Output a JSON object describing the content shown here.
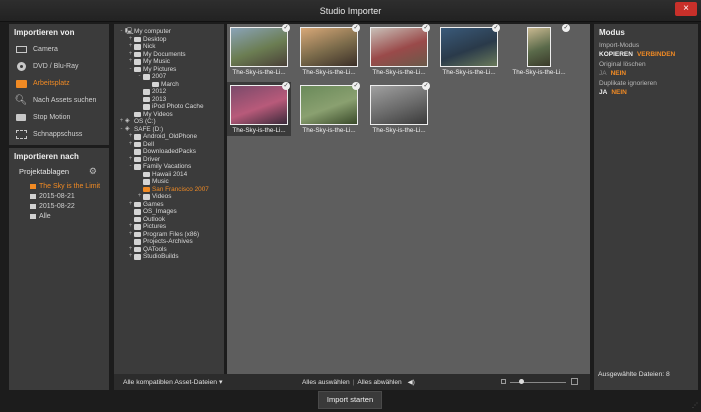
{
  "window": {
    "title": "Studio Importer",
    "close_glyph": "×"
  },
  "import_from": {
    "header": "Importieren von",
    "items": [
      {
        "label": "Camera",
        "icon": "camera-icon",
        "active": false
      },
      {
        "label": "DVD / Blu-Ray",
        "icon": "disc-icon",
        "active": false
      },
      {
        "label": "Arbeitsplatz",
        "icon": "folder-icon",
        "active": true
      },
      {
        "label": "Nach Assets suchen",
        "icon": "search-icon",
        "active": false
      },
      {
        "label": "Stop Motion",
        "icon": "stop-motion-icon",
        "active": false
      },
      {
        "label": "Schnappschuss",
        "icon": "snapshot-icon",
        "active": false
      }
    ]
  },
  "import_to": {
    "header": "Importieren nach",
    "templates_label": "Projektablagen",
    "projects": [
      {
        "label": "The Sky is the Limit",
        "active": true
      },
      {
        "label": "2015-08-21",
        "active": false
      },
      {
        "label": "2015-08-22",
        "active": false
      },
      {
        "label": "Alle",
        "active": false
      }
    ]
  },
  "tree": [
    {
      "label": "My computer",
      "level": 0,
      "tw": "-",
      "icon": "computer",
      "active": false
    },
    {
      "label": "Desktop",
      "level": 1,
      "tw": "+",
      "icon": "folder",
      "active": false
    },
    {
      "label": "Nick",
      "level": 1,
      "tw": "+",
      "icon": "folder",
      "active": false
    },
    {
      "label": "My Documents",
      "level": 1,
      "tw": "+",
      "icon": "folder",
      "active": false
    },
    {
      "label": "My Music",
      "level": 1,
      "tw": "+",
      "icon": "folder",
      "active": false
    },
    {
      "label": "My Pictures",
      "level": 1,
      "tw": "-",
      "icon": "folder",
      "active": false
    },
    {
      "label": "2007",
      "level": 2,
      "tw": "-",
      "icon": "folder",
      "active": false
    },
    {
      "label": "March",
      "level": 3,
      "tw": "",
      "icon": "folder",
      "active": false
    },
    {
      "label": "2012",
      "level": 2,
      "tw": "",
      "icon": "folder",
      "active": false
    },
    {
      "label": "2013",
      "level": 2,
      "tw": "",
      "icon": "folder",
      "active": false
    },
    {
      "label": "iPod Photo Cache",
      "level": 2,
      "tw": "",
      "icon": "folder",
      "active": false
    },
    {
      "label": "My Videos",
      "level": 1,
      "tw": "",
      "icon": "folder",
      "active": false
    },
    {
      "label": "OS (C:)",
      "level": 0,
      "tw": "+",
      "icon": "drive",
      "active": false
    },
    {
      "label": "SAFE (D:)",
      "level": 0,
      "tw": "-",
      "icon": "drive",
      "active": false
    },
    {
      "label": "Android_OldPhone",
      "level": 1,
      "tw": "+",
      "icon": "folder",
      "active": false
    },
    {
      "label": "Dell",
      "level": 1,
      "tw": "+",
      "icon": "folder",
      "active": false
    },
    {
      "label": "DownloadedPacks",
      "level": 1,
      "tw": "",
      "icon": "folder",
      "active": false
    },
    {
      "label": "Driver",
      "level": 1,
      "tw": "+",
      "icon": "folder",
      "active": false
    },
    {
      "label": "Family Vacations",
      "level": 1,
      "tw": "-",
      "icon": "folder",
      "active": false
    },
    {
      "label": "Hawaii 2014",
      "level": 2,
      "tw": "",
      "icon": "folder",
      "active": false
    },
    {
      "label": "Music",
      "level": 2,
      "tw": "",
      "icon": "folder",
      "active": false
    },
    {
      "label": "San Francisco 2007",
      "level": 2,
      "tw": "",
      "icon": "folder",
      "active": true
    },
    {
      "label": "Videos",
      "level": 2,
      "tw": "+",
      "icon": "folder",
      "active": false
    },
    {
      "label": "Games",
      "level": 1,
      "tw": "+",
      "icon": "folder",
      "active": false
    },
    {
      "label": "OS_Images",
      "level": 1,
      "tw": "",
      "icon": "folder",
      "active": false
    },
    {
      "label": "Outlook",
      "level": 1,
      "tw": "",
      "icon": "folder",
      "active": false
    },
    {
      "label": "Pictures",
      "level": 1,
      "tw": "+",
      "icon": "folder",
      "active": false
    },
    {
      "label": "Program Files (x86)",
      "level": 1,
      "tw": "+",
      "icon": "folder",
      "active": false
    },
    {
      "label": "Projects-Archives",
      "level": 1,
      "tw": "",
      "icon": "folder",
      "active": false
    },
    {
      "label": "QATools",
      "level": 1,
      "tw": "+",
      "icon": "folder",
      "active": false
    },
    {
      "label": "StudioBuilds",
      "level": 1,
      "tw": "+",
      "icon": "folder",
      "active": false
    }
  ],
  "thumbnails": [
    {
      "caption": "The-Sky-is-the-Li...",
      "selected": false,
      "portrait": false,
      "checked": true,
      "colors": [
        "#8aa3b8",
        "#6b7d52",
        "#4a4038"
      ]
    },
    {
      "caption": "The-Sky-is-the-Li...",
      "selected": false,
      "portrait": false,
      "checked": true,
      "colors": [
        "#d8a878",
        "#7a6a4a",
        "#3b2f28"
      ]
    },
    {
      "caption": "The-Sky-is-the-Li...",
      "selected": false,
      "portrait": false,
      "checked": true,
      "colors": [
        "#c8c0b8",
        "#9a4a4a",
        "#6a5a4a"
      ]
    },
    {
      "caption": "The-Sky-is-the-Li...",
      "selected": false,
      "portrait": false,
      "checked": true,
      "colors": [
        "#3a5a7a",
        "#2a3a4a",
        "#6a7a5a"
      ]
    },
    {
      "caption": "The-Sky-is-the-Li...",
      "selected": false,
      "portrait": true,
      "checked": true,
      "colors": [
        "#c8b890",
        "#5a6a4a",
        "#3a3a2a"
      ]
    },
    {
      "caption": "The-Sky-is-the-Li...",
      "selected": true,
      "portrait": false,
      "checked": true,
      "colors": [
        "#7a4a6a",
        "#b85a7a",
        "#3a2a3a"
      ]
    },
    {
      "caption": "The-Sky-is-the-Li...",
      "selected": false,
      "portrait": false,
      "checked": true,
      "colors": [
        "#6a8a5a",
        "#8aa070",
        "#3a4a2a"
      ]
    },
    {
      "caption": "The-Sky-is-the-Li...",
      "selected": false,
      "portrait": false,
      "checked": true,
      "colors": [
        "#a0a0a0",
        "#6a6a6a",
        "#3a3a3a"
      ]
    }
  ],
  "mode_panel": {
    "header": "Modus",
    "import_mode_label": "Import-Modus",
    "import_mode_on": "KOPIEREN",
    "import_mode_off": "VERBINDEN",
    "delete_original_label": "Original löschen",
    "delete_original_yes": "JA",
    "delete_original_no": "NEIN",
    "ignore_duplicates_label": "Duplikate ignorieren",
    "ignore_duplicates_yes": "JA",
    "ignore_duplicates_no": "NEIN",
    "selected_files": "Ausgewählte Dateien: 8"
  },
  "bottom": {
    "filter_label": "Alle kompatiblen Asset-Dateien",
    "filter_caret": "▾",
    "select_all": "Alles auswählen",
    "separator": "|",
    "deselect_all": "Alles abwählen",
    "speaker_glyph": "◀)",
    "import_button": "Import starten"
  },
  "colors": {
    "accent": "#f08a24",
    "panel": "#3b3b3b",
    "content": "#5e5e5e",
    "close": "#c8302a"
  }
}
